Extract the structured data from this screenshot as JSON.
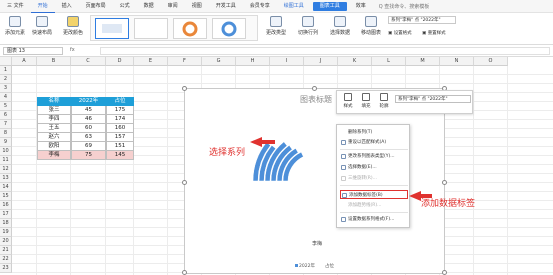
{
  "menubar": {
    "items": [
      "三 文件",
      "开始",
      "插入",
      "页面布局",
      "公式",
      "数据",
      "审阅",
      "视图",
      "开发工具",
      "会员专享",
      "绘图工具",
      "图表工具",
      "效率"
    ],
    "search": "Q 查找命令、搜索模板"
  },
  "ribbon": {
    "buttons": [
      "添加元素",
      "快速布局",
      "更改颜色",
      "更改类型",
      "切换行列",
      "选择数据",
      "移动图表"
    ],
    "series_select": "系列\"李梅\" 点 \"2022年\"",
    "format_selection": "设置格式",
    "reset_style": "重置样式"
  },
  "formula": {
    "name_box": "图表 13",
    "fx": "fx"
  },
  "columns": [
    "A",
    "B",
    "C",
    "D",
    "E",
    "F",
    "G",
    "H",
    "I",
    "J",
    "K",
    "L",
    "M",
    "N",
    "O"
  ],
  "rows": [
    "1",
    "2",
    "3",
    "4",
    "5",
    "6",
    "7",
    "8",
    "9",
    "10",
    "11",
    "12",
    "13",
    "14",
    "15",
    "16",
    "17",
    "18",
    "19",
    "20",
    "21",
    "22",
    "23"
  ],
  "table": {
    "headers": [
      "名称",
      "2022年",
      "占位"
    ],
    "rows": [
      [
        "张三",
        "45",
        "175"
      ],
      [
        "李四",
        "46",
        "174"
      ],
      [
        "王五",
        "60",
        "160"
      ],
      [
        "赵六",
        "63",
        "157"
      ],
      [
        "欧阳",
        "69",
        "151"
      ],
      [
        "李梅",
        "75",
        "145"
      ]
    ]
  },
  "chart": {
    "title": "图表标题",
    "axis_label": "李梅",
    "legend": [
      "2022年",
      "占位"
    ],
    "series_color": "#4d8fd9"
  },
  "chart_data": {
    "type": "pie",
    "title": "图表标题",
    "categories": [
      "张三",
      "李四",
      "王五",
      "赵六",
      "欧阳",
      "李梅"
    ],
    "series": [
      {
        "name": "2022年",
        "values": [
          45,
          46,
          60,
          63,
          69,
          75
        ]
      },
      {
        "name": "占位",
        "values": [
          175,
          174,
          160,
          157,
          151,
          145
        ]
      }
    ],
    "legend": "bottom"
  },
  "minibar": {
    "style": "样式",
    "fill": "填充",
    "outline": "轮廓",
    "series_select": "系列\"李梅\" 点 \"2022年\""
  },
  "context_menu": {
    "items": [
      {
        "label": "删除系列(T)",
        "disabled": false
      },
      {
        "label": "重设以匹配样式(A)",
        "disabled": false
      },
      {
        "label": "更改系列图表类型(Y)...",
        "disabled": false
      },
      {
        "label": "选择数据(E)...",
        "disabled": false
      },
      {
        "label": "三维旋转(R)...",
        "disabled": true
      },
      {
        "label": "添加数据标签(B)",
        "disabled": false
      },
      {
        "label": "添加趋势线(R)...",
        "disabled": true
      },
      {
        "label": "设置数据系列格式(F)...",
        "disabled": false
      }
    ]
  },
  "annotations": {
    "select_series": "选择系列",
    "add_labels": "添加数据标签"
  },
  "colors": {
    "header_blue": "#1e9fd8",
    "annotation_red": "#e0322f",
    "highlight_row": "#f6d0cf"
  }
}
